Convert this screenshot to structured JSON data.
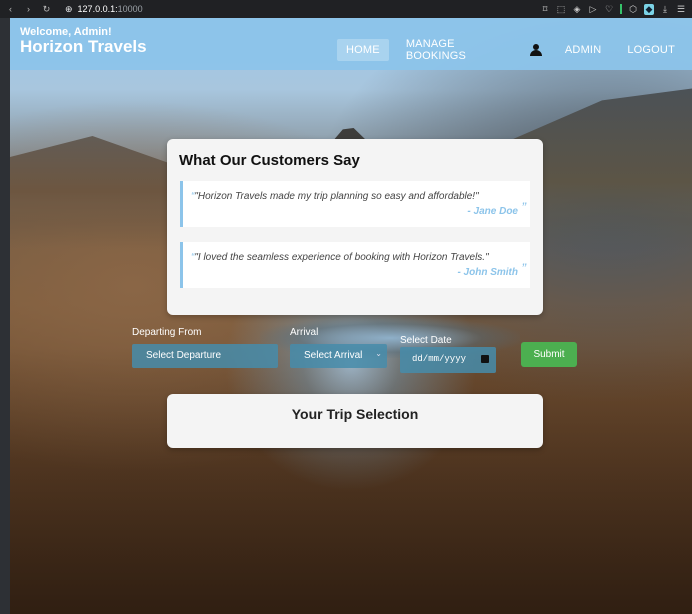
{
  "browser": {
    "url_host": "127.0.0.1:",
    "url_port": "10000"
  },
  "header": {
    "welcome": "Welcome, Admin!",
    "brand": "Horizon Travels",
    "nav": {
      "home": "HOME",
      "manage_bookings": "MANAGE BOOKINGS",
      "admin": "ADMIN",
      "logout": "LOGOUT"
    }
  },
  "testimonials": {
    "title": "What Our Customers Say",
    "items": [
      {
        "text": "\"Horizon Travels made my trip planning so easy and affordable!\"",
        "author": "- Jane Doe"
      },
      {
        "text": "\"I loved the seamless experience of booking with Horizon Travels.\"",
        "author": "- John Smith"
      }
    ]
  },
  "booking": {
    "departing_label": "Departing From",
    "departing_value": "Select Departure",
    "arrival_label": "Arrival",
    "arrival_value": "Select Arrival",
    "date_label": "Select Date",
    "date_placeholder": "dd/mm/yyyy",
    "submit": "Submit"
  },
  "trip": {
    "title": "Your Trip Selection"
  },
  "colors": {
    "header_bg": "#8cc4ea",
    "accent": "#8cc4ea",
    "submit_bg": "#4caf50"
  }
}
